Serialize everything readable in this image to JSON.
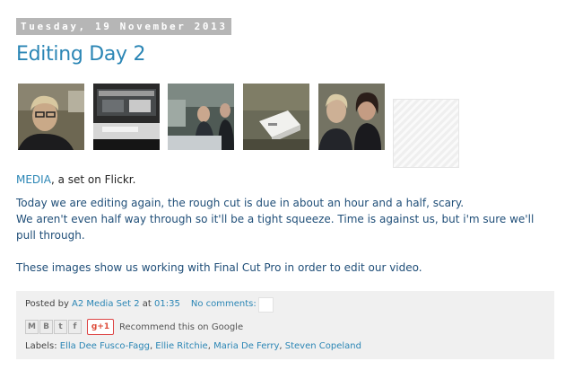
{
  "post": {
    "date": "Tuesday, 19 November 2013",
    "title": "Editing Day 2"
  },
  "flickr": {
    "set_link": "MEDIA",
    "suffix": ", a set on Flickr."
  },
  "body": {
    "para1_line1": "Today we are editing again, the rough cut is due in about an hour and a half, scary.",
    "para1_line2": "We aren't even half way through so it'll be a tight squeeze. Time is against us, but i'm sure we'll pull through.",
    "para2": "These images show us working with Final Cut Pro in order to edit our video."
  },
  "footer": {
    "posted_by_prefix": "Posted by ",
    "author": "A2 Media Set 2",
    "at": " at ",
    "time": "01:35",
    "comments": "No comments:",
    "share_icons": [
      "email-icon",
      "blogger-icon",
      "twitter-icon",
      "facebook-icon"
    ],
    "gplus_label": "g+1",
    "recommend": "Recommend this on Google",
    "labels_prefix": "Labels: ",
    "labels": [
      "Ella Dee Fusco-Fagg",
      "Ellie Ritchie",
      "Maria De Ferry",
      "Steven Copeland"
    ],
    "label_separator": ", "
  },
  "colors": {
    "link": "#2b86b5",
    "date_bg": "#b6b6b6",
    "footer_bg": "#f0f0f0"
  }
}
